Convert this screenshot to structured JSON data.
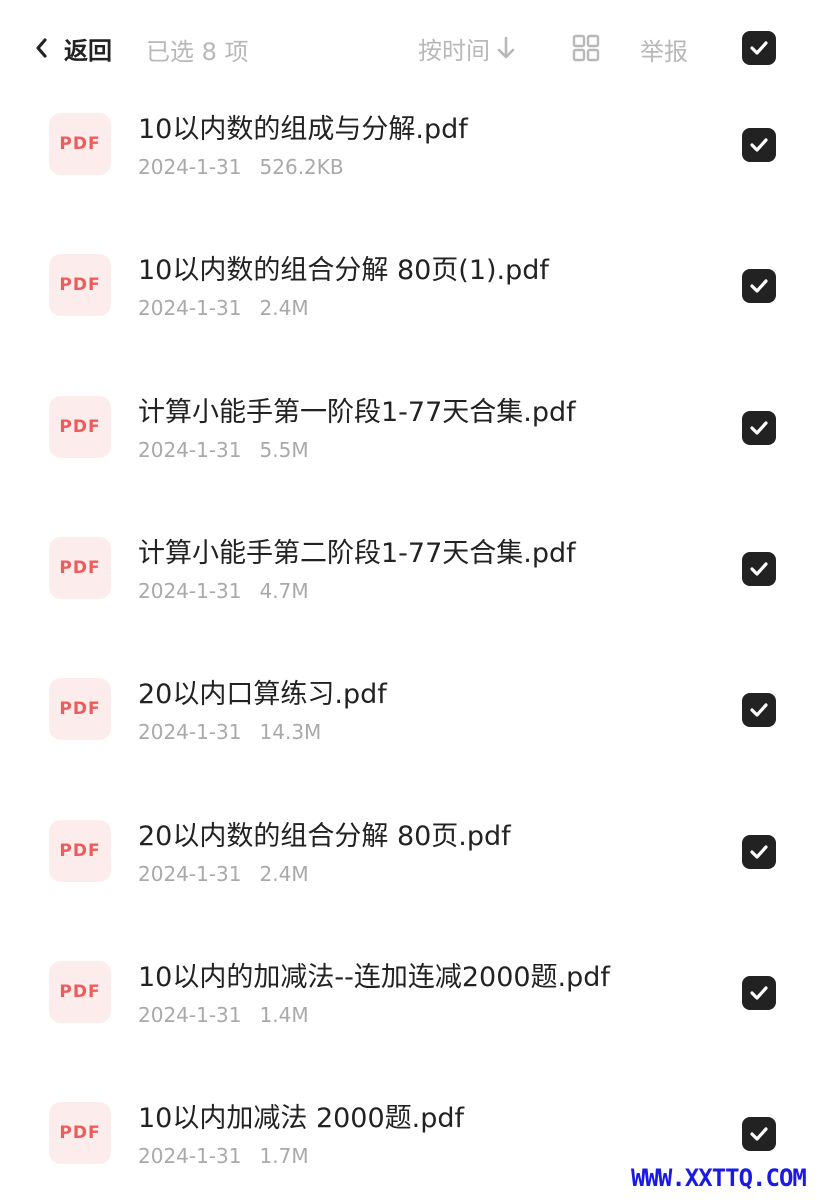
{
  "header": {
    "back_label": "返回",
    "selected_text": "已选 8 项",
    "sort_label": "按时间",
    "report_label": "举报",
    "select_all_checked": true
  },
  "icons": {
    "back": "chevron-left-icon",
    "sort": "arrow-down-icon",
    "view": "grid-view-icon",
    "check": "check-icon",
    "file": "pdf-file-icon"
  },
  "colors": {
    "checkbox_fill": "#222222",
    "pdf_icon_bg": "#fdecec",
    "pdf_icon_text": "#ef5b5b",
    "muted_text": "#a9a9a9",
    "watermark": "#1a1ae6"
  },
  "files": [
    {
      "icon_label": "PDF",
      "name": "10以内数的组成与分解.pdf",
      "date": "2024-1-31",
      "size": "526.2KB",
      "checked": true
    },
    {
      "icon_label": "PDF",
      "name": "10以内数的组合分解 80页(1).pdf",
      "date": "2024-1-31",
      "size": "2.4M",
      "checked": true
    },
    {
      "icon_label": "PDF",
      "name": "计算小能手第一阶段1-77天合集.pdf",
      "date": "2024-1-31",
      "size": "5.5M",
      "checked": true
    },
    {
      "icon_label": "PDF",
      "name": "计算小能手第二阶段1-77天合集.pdf",
      "date": "2024-1-31",
      "size": "4.7M",
      "checked": true
    },
    {
      "icon_label": "PDF",
      "name": "20以内口算练习.pdf",
      "date": "2024-1-31",
      "size": "14.3M",
      "checked": true
    },
    {
      "icon_label": "PDF",
      "name": "20以内数的组合分解 80页.pdf",
      "date": "2024-1-31",
      "size": "2.4M",
      "checked": true
    },
    {
      "icon_label": "PDF",
      "name": "10以内的加减法--连加连减2000题.pdf",
      "date": "2024-1-31",
      "size": "1.4M",
      "checked": true
    },
    {
      "icon_label": "PDF",
      "name": "10以内加减法 2000题.pdf",
      "date": "2024-1-31",
      "size": "1.7M",
      "checked": true
    }
  ],
  "watermark": "WWW.XXTTQ.COM"
}
